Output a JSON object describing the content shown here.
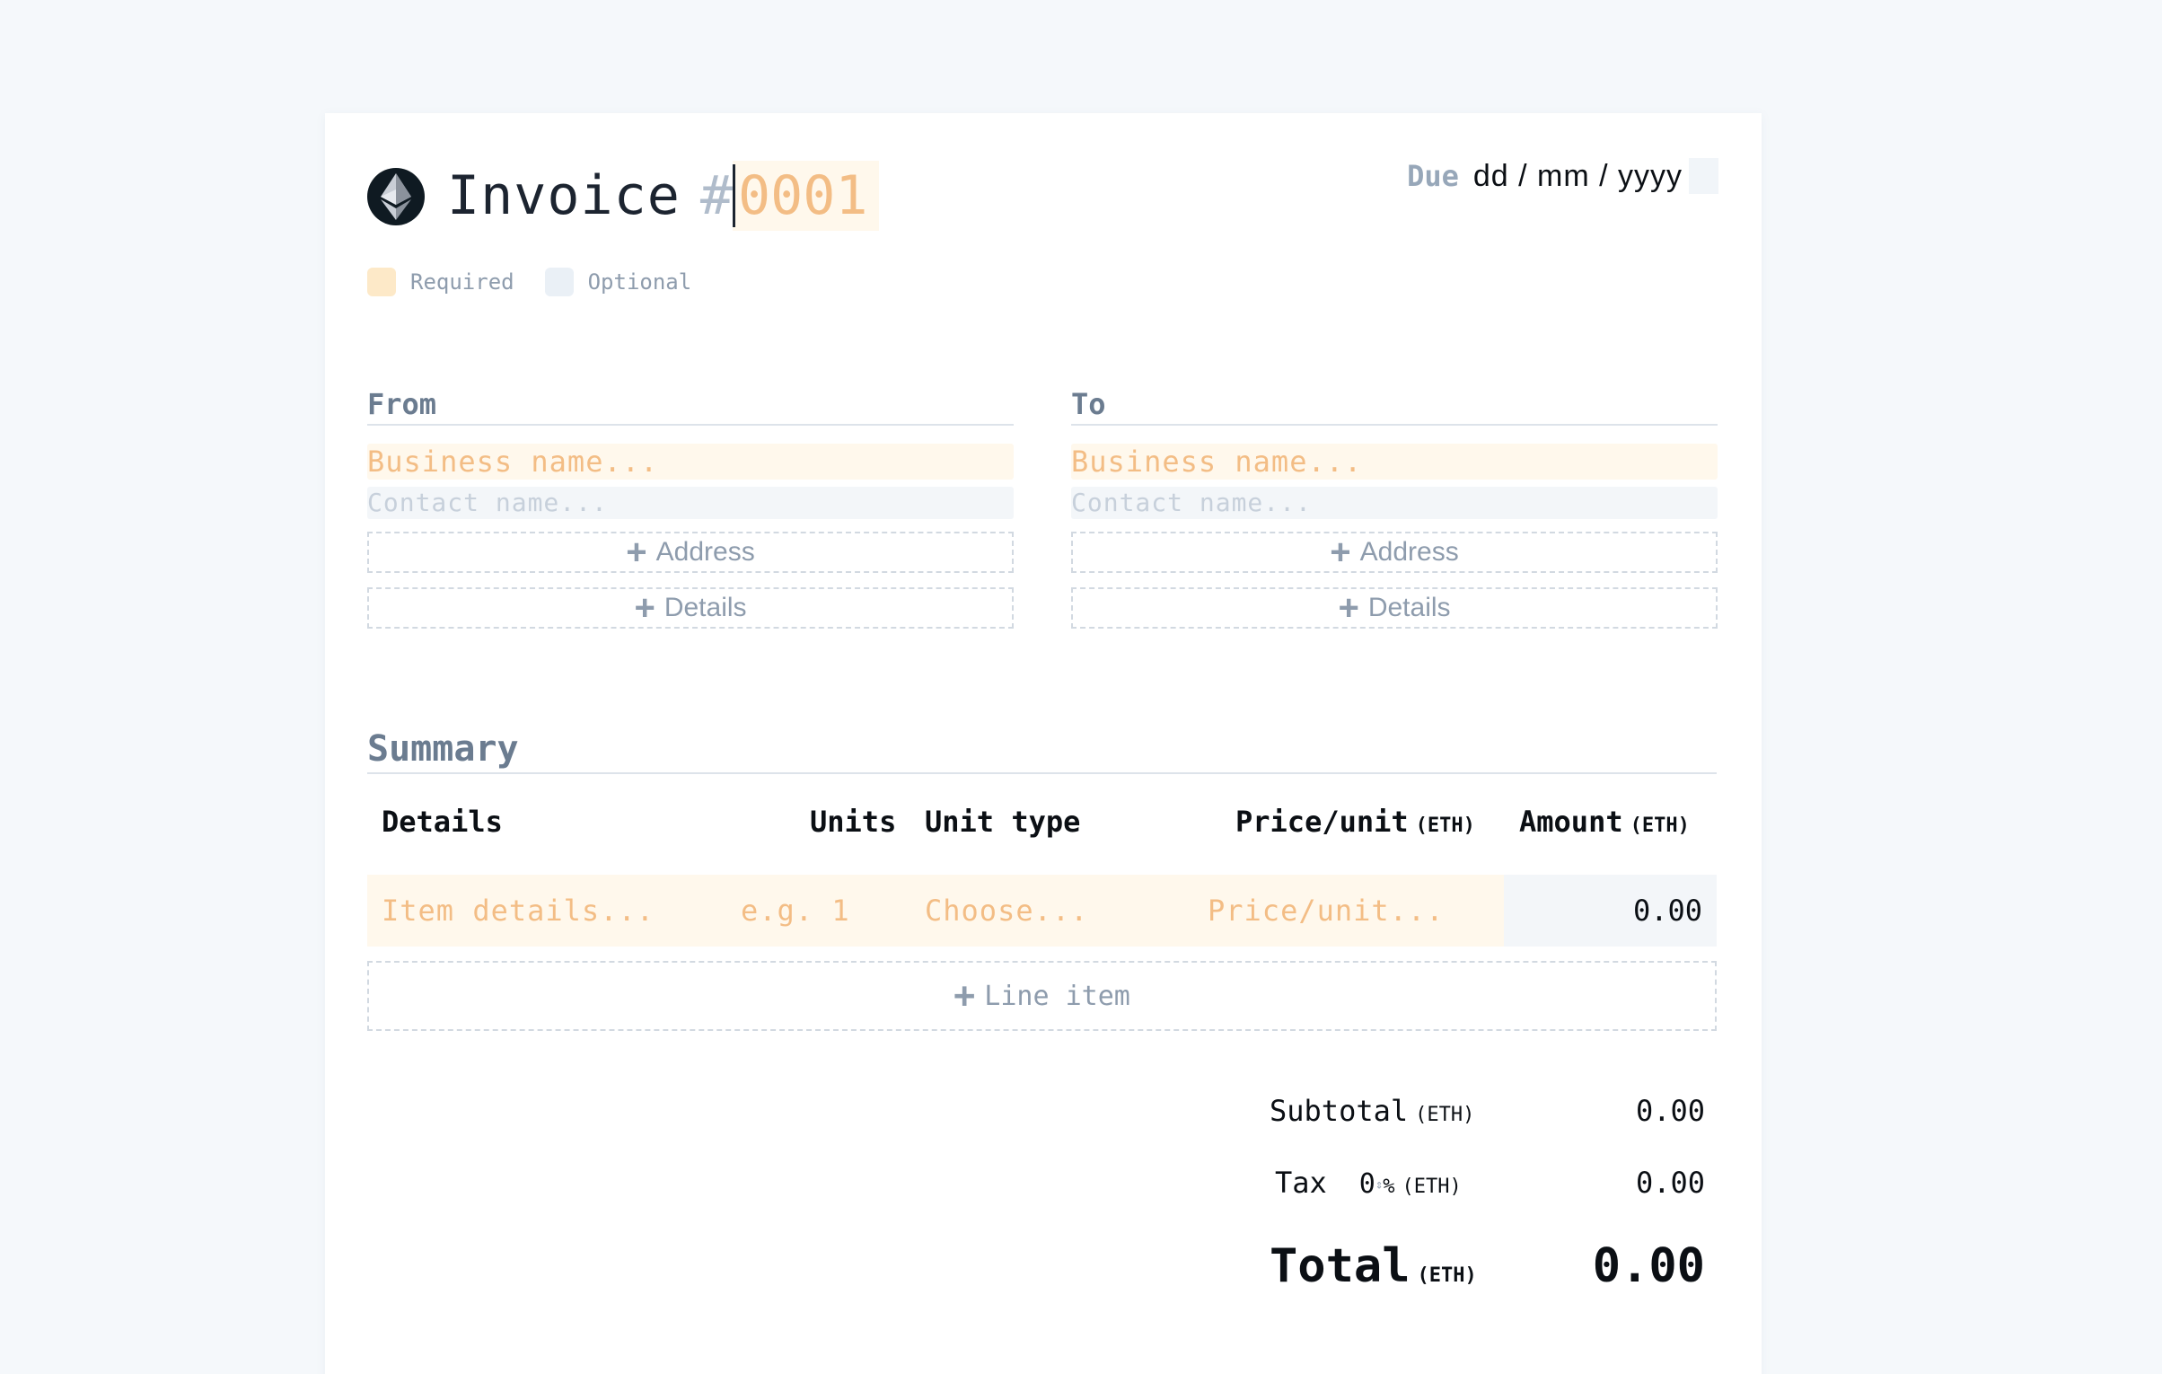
{
  "header": {
    "title": "Invoice",
    "hash": "#",
    "invoice_number": "0001",
    "due_label": "Due",
    "due_placeholder": "dd / mm / yyyy"
  },
  "legend": {
    "required": "Required",
    "optional": "Optional"
  },
  "from": {
    "heading": "From",
    "business_placeholder": "Business name...",
    "contact_placeholder": "Contact name...",
    "address_button": "Address",
    "details_button": "Details"
  },
  "to": {
    "heading": "To",
    "business_placeholder": "Business name...",
    "contact_placeholder": "Contact name...",
    "address_button": "Address",
    "details_button": "Details"
  },
  "summary": {
    "heading": "Summary",
    "columns": {
      "details": "Details",
      "units": "Units",
      "unit_type": "Unit type",
      "price_unit": "Price/unit",
      "price_unit_currency": "(ETH)",
      "amount": "Amount",
      "amount_currency": "(ETH)"
    },
    "line": {
      "details_placeholder": "Item details...",
      "units_placeholder": "e.g. 1",
      "unit_type_placeholder": "Choose...",
      "price_placeholder": "Price/unit...",
      "amount": "0.00"
    },
    "add_line_button": "Line item"
  },
  "totals": {
    "subtotal_label": "Subtotal",
    "subtotal_currency": "(ETH)",
    "subtotal_value": "0.00",
    "tax_label": "Tax",
    "tax_rate": "0",
    "tax_percent": "%",
    "tax_currency": "(ETH)",
    "tax_value": "0.00",
    "total_label": "Total",
    "total_currency": "(ETH)",
    "total_value": "0.00"
  },
  "colors": {
    "required_bg": "#fff8ec",
    "required_text": "#f3bd85",
    "optional_bg": "#f3f6f9",
    "muted": "#8e9cad"
  }
}
